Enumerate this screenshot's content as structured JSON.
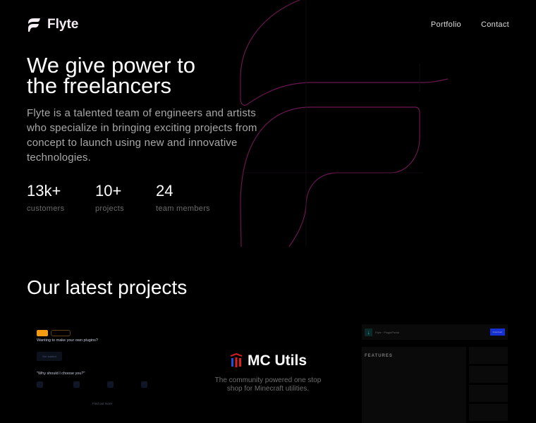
{
  "brand": {
    "name": "Flyte"
  },
  "nav": {
    "items": [
      "Portfolio",
      "Contact"
    ]
  },
  "hero": {
    "title_line1": "We give power to",
    "title_line2": "the freelancers",
    "description": "Flyte is a talented team of engineers and artists who specialize in bringing exciting projects from concept to launch using new and innovative technologies."
  },
  "stats": [
    {
      "value": "13k+",
      "label": "customers"
    },
    {
      "value": "10+",
      "label": "projects"
    },
    {
      "value": "24",
      "label": "team members"
    }
  ],
  "projects": {
    "heading": "Our latest projects",
    "items": [
      {
        "heading": "Wanting to make your own plugins?",
        "subheading": "\"Why should I choose you?\"",
        "link": "Find out more",
        "button": "Get started"
      },
      {
        "name": "MC Utils",
        "description": "The community powered one stop shop for Minecraft utilities."
      },
      {
        "title": "Flyte · PluginPortal",
        "section": "FEATURES",
        "download": "Download"
      }
    ]
  },
  "colors": {
    "accent": "#b0206f",
    "orange": "#f39c12",
    "blue": "#1531d4"
  }
}
